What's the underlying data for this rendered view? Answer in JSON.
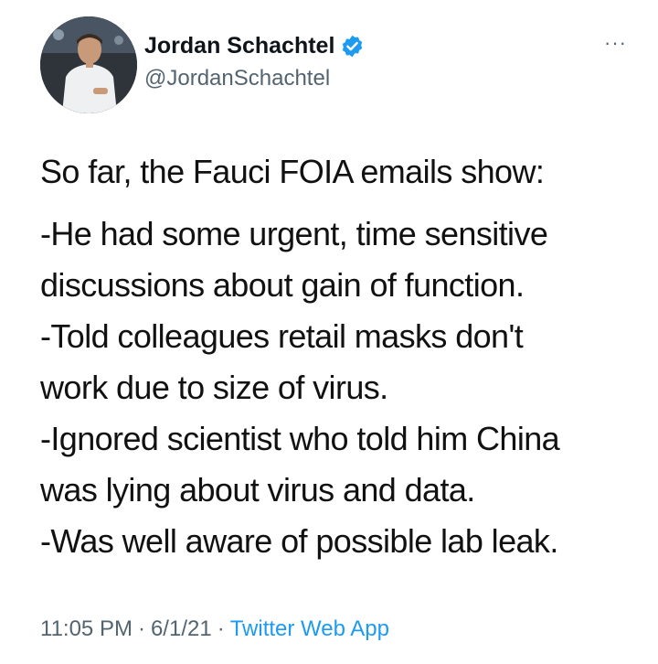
{
  "user": {
    "display_name": "Jordan Schachtel",
    "handle": "@JordanSchachtel",
    "verified": true
  },
  "menu": {
    "more_label": "···"
  },
  "tweet": {
    "intro": "So far, the Fauci FOIA emails show:",
    "lines": [
      "-He had some urgent, time sensitive",
      "discussions about gain of function.",
      "-Told colleagues retail masks don't",
      "work due to size of virus.",
      "-Ignored scientist who told him China",
      "was lying about virus and data.",
      "-Was well aware of possible lab leak."
    ]
  },
  "meta": {
    "time": "11:05 PM",
    "separator": "·",
    "date": "6/1/21",
    "source": "Twitter Web App"
  },
  "colors": {
    "accent": "#1d9bf0",
    "secondary_text": "#536471",
    "primary_text": "#0f1419"
  }
}
